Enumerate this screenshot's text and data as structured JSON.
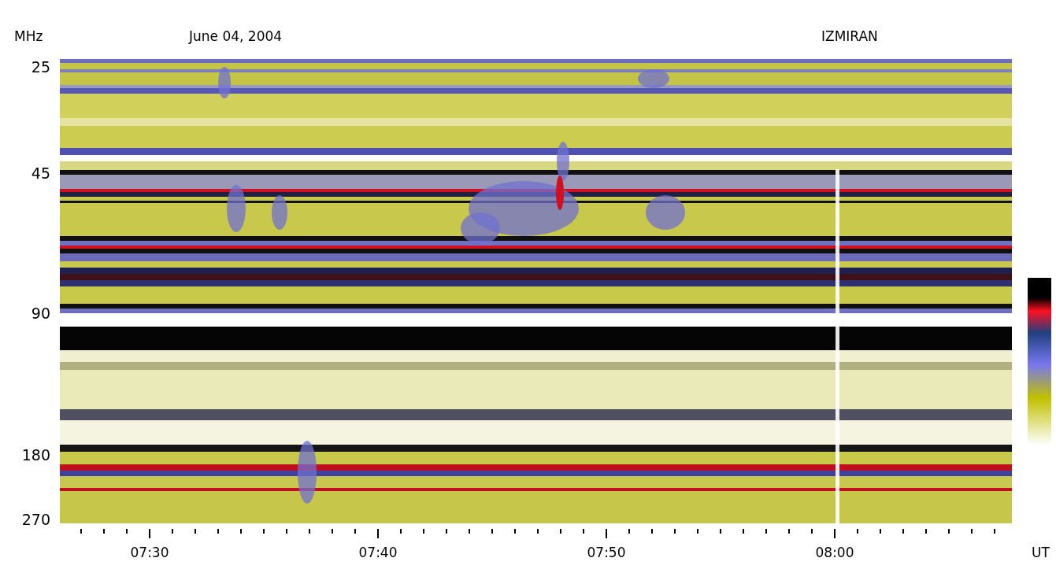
{
  "header": {
    "date": "June 04, 2004",
    "station": "IZMIRAN"
  },
  "y_axis": {
    "unit": "MHz",
    "labels": [
      "25",
      "45",
      "90",
      "180",
      "270"
    ]
  },
  "x_axis": {
    "unit": "UT",
    "labels": [
      "07:30",
      "07:40",
      "07:50",
      "08:00"
    ]
  }
}
